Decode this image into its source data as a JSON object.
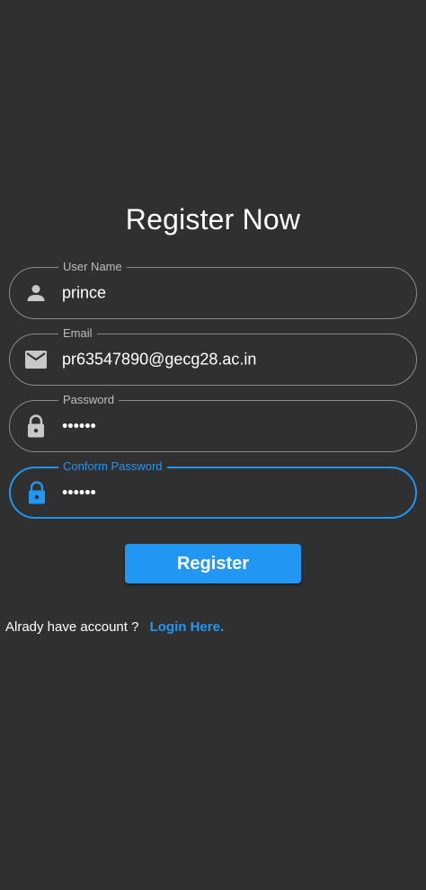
{
  "title": "Register Now",
  "fields": {
    "username": {
      "label": "User Name",
      "value": "prince",
      "icon": "person-icon"
    },
    "email": {
      "label": "Email",
      "value": "pr63547890@gecg28.ac.in",
      "icon": "mail-icon"
    },
    "password": {
      "label": "Password",
      "value": "••••••",
      "icon": "lock-icon"
    },
    "confirm_password": {
      "label": "Conform Password",
      "value": "••••••",
      "icon": "lock-icon",
      "focused": true
    }
  },
  "register_button": {
    "label": "Register"
  },
  "footer": {
    "prompt": "Alrady have account ?",
    "link": "Login Here."
  },
  "colors": {
    "background": "#303030",
    "accent": "#2196f3",
    "border": "#8a8a8a",
    "label": "#bdbdbd",
    "icon": "#c8c8c8"
  }
}
